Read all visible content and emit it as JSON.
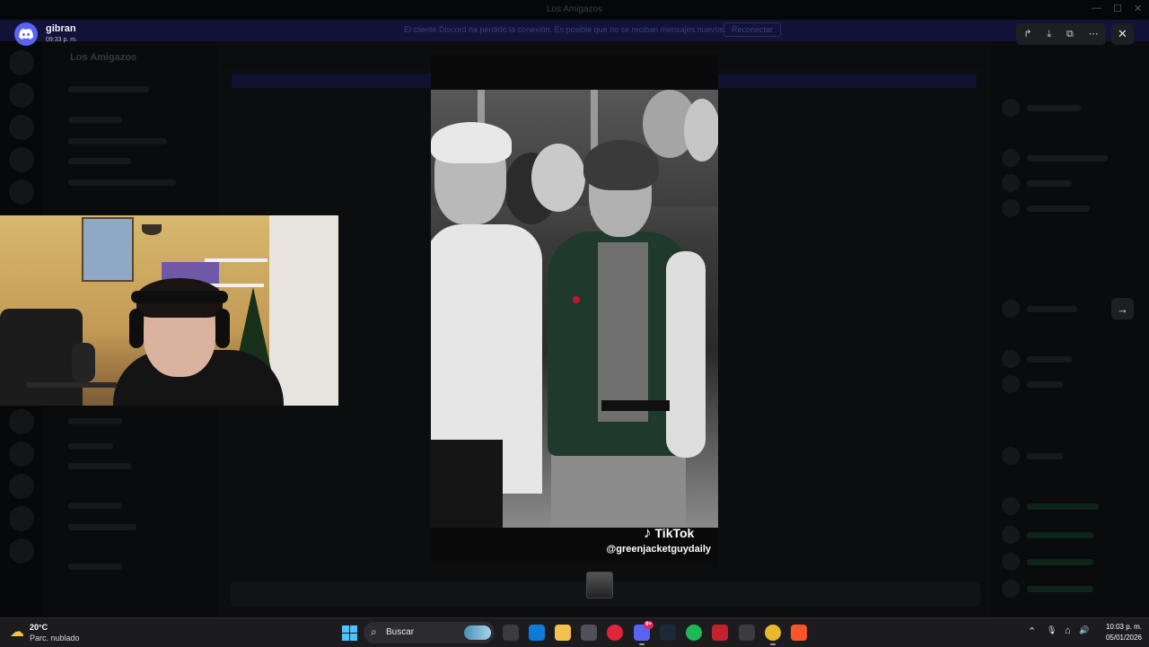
{
  "window": {
    "title": "Los Amigazos",
    "minimize": "—",
    "maximize": "☐",
    "close": "✕"
  },
  "discord_bg": {
    "notice_text": "El cliente Discord ha perdido la conexión. Es posible que no se reciban mensajes nuevos.",
    "notice_link": "Reconectar",
    "server_name": "Los Amigazos"
  },
  "viewer": {
    "sender_name": "gibran",
    "sender_time": "09:33 p. m.",
    "tools": {
      "forward": "↱",
      "download": "⤓",
      "open": "⧉",
      "more": "⋯"
    },
    "close": "✕",
    "next": "→"
  },
  "video": {
    "brand": "TikTok",
    "brand_glyph": "♪",
    "username": "@greenjacketguydaily"
  },
  "taskbar": {
    "weather_icon": "☁",
    "weather_temp": "20°C",
    "weather_desc": "Parc. nublado",
    "search_icon": "⌕",
    "search_label": "Buscar",
    "discord_badge": "9+",
    "clock_time": "10:03 p. m.",
    "clock_date": "05/01/2026",
    "tray_chevron": "⌃",
    "tray_mic": "🎙",
    "tray_network": "⌂",
    "tray_volume": "🔊"
  },
  "colors": {
    "discord_blurple": "#5865f2",
    "windows_accent": "#4cc2ff",
    "taskbar_bg": "#1c1c1f"
  }
}
